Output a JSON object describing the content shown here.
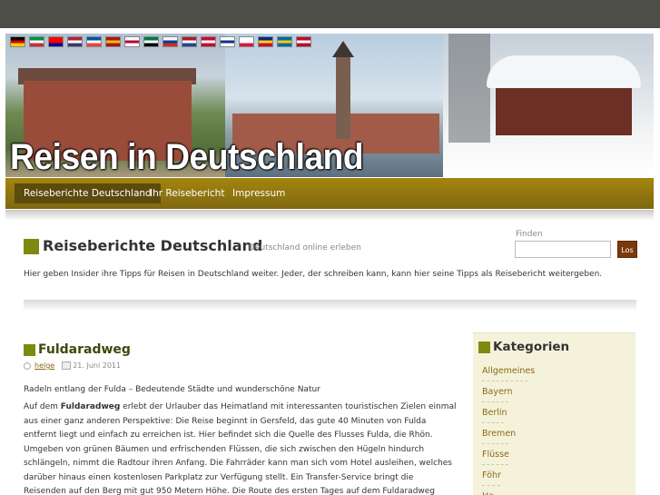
{
  "header": {
    "site_title": "Reisen in Deutschland",
    "flags": [
      {
        "name": "german",
        "colors": [
          "#000000",
          "#dd0000",
          "#ffce00"
        ]
      },
      {
        "name": "italian",
        "colors": [
          "#009246",
          "#ffffff",
          "#ce2b37"
        ]
      },
      {
        "name": "chinese-taiwan",
        "colors": [
          "#fe0000",
          "#fe0000",
          "#000095"
        ]
      },
      {
        "name": "usa",
        "colors": [
          "#b22234",
          "#ffffff",
          "#3c3b6e"
        ]
      },
      {
        "name": "french",
        "colors": [
          "#0055a4",
          "#ffffff",
          "#ef4135"
        ]
      },
      {
        "name": "spanish",
        "colors": [
          "#aa151b",
          "#f1bf00",
          "#aa151b"
        ]
      },
      {
        "name": "japanese",
        "colors": [
          "#ffffff",
          "#bc002d",
          "#ffffff"
        ]
      },
      {
        "name": "arabic",
        "colors": [
          "#007a3d",
          "#ffffff",
          "#000000"
        ]
      },
      {
        "name": "russian",
        "colors": [
          "#ffffff",
          "#0039a6",
          "#d52b1e"
        ]
      },
      {
        "name": "dutch",
        "colors": [
          "#ae1c28",
          "#ffffff",
          "#21468b"
        ]
      },
      {
        "name": "danish",
        "colors": [
          "#c60c30",
          "#ffffff",
          "#c60c30"
        ]
      },
      {
        "name": "finnish",
        "colors": [
          "#ffffff",
          "#003580",
          "#ffffff"
        ]
      },
      {
        "name": "polish",
        "colors": [
          "#ffffff",
          "#ffffff",
          "#dc143c"
        ]
      },
      {
        "name": "romanian",
        "colors": [
          "#002b7f",
          "#fcd116",
          "#ce1126"
        ]
      },
      {
        "name": "swedish",
        "colors": [
          "#006aa7",
          "#fecc00",
          "#006aa7"
        ]
      },
      {
        "name": "norwegian",
        "colors": [
          "#ba0c2f",
          "#ffffff",
          "#ba0c2f"
        ]
      }
    ]
  },
  "nav": {
    "items": [
      {
        "label": "Reiseberichte Deutschland",
        "active": true
      },
      {
        "label": "Ihr Reisebericht",
        "active": false
      },
      {
        "label": "Impressum",
        "active": false
      }
    ]
  },
  "blog": {
    "title": "Reiseberichte Deutschland",
    "description": "Deutschland online erleben",
    "intro": "Hier geben Insider ihre Tipps für Reisen in Deutschland weiter. Jeder, der schreiben kann, kann hier seine Tipps als Reisebericht weitergeben."
  },
  "search": {
    "label": "Finden",
    "placeholder": "",
    "button": "Los"
  },
  "post": {
    "title": "Fuldaradweg",
    "author": "helge",
    "date": "21. Juni 2011",
    "subtitle": "Radeln entlang der Fulda – Bedeutende Städte und wunderschöne Natur",
    "lead_prefix": "Auf dem ",
    "lead_bold": "Fuldaradweg",
    "lead_rest": " erlebt der Urlauber das Heimatland mit interessanten touristischen Zielen einmal",
    "lines": [
      "aus einer ganz anderen Perspektive: Die Reise beginnt in Gersfeld, das gute 40 Minuten von Fulda",
      "entfernt liegt und einfach zu erreichen ist. Hier befindet sich die Quelle des Flusses Fulda, die Rhön.",
      "Umgeben von grünen Bäumen und erfrischenden Flüssen, die sich zwischen den Hügeln hindurch",
      "schlängeln, nimmt die Radtour ihren Anfang. Die Fahrräder kann man sich vom Hotel ausleihen, welches",
      "darüber hinaus einen kostenlosen Parkplatz zur Verfügung stellt. Ein Transfer-Service bringt die",
      "Reisenden auf den Berg mit gut 950 Metern Höhe. Die Route des ersten Tages auf dem Fuldaradweg"
    ]
  },
  "sidebar": {
    "title": "Kategorien",
    "categories": [
      "Allgemeines",
      "Bayern",
      "Berlin",
      "Bremen",
      "Flüsse",
      "Föhr",
      "Ha"
    ]
  },
  "colors": {
    "topbar": "#4d4e48",
    "nav": "#917610",
    "nav_active": "#5b4b0d",
    "accent_square": "#7d8a10",
    "link": "#8a6a10",
    "search_button": "#7a3a08",
    "sidebar_bg": "#f5f2dc"
  }
}
